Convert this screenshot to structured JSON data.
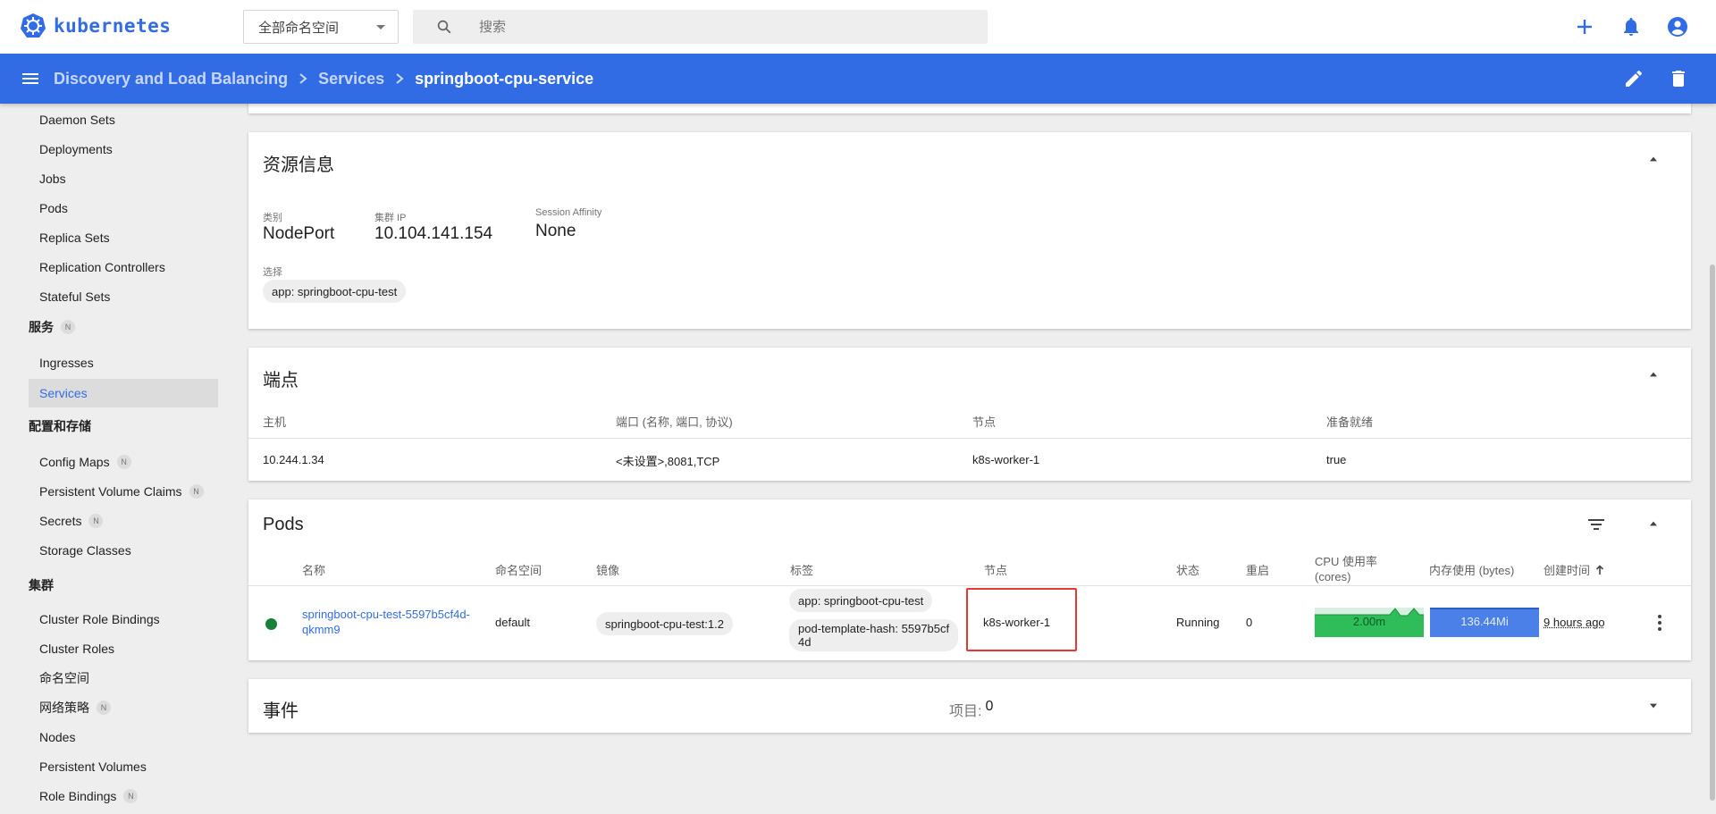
{
  "app": {
    "logo_text": "kubernetes"
  },
  "topbar": {
    "namespace_selected": "全部命名空间",
    "search_placeholder": "搜索"
  },
  "header": {
    "breadcrumbs": [
      "Discovery and Load Balancing",
      "Services",
      "springboot-cpu-service"
    ]
  },
  "sidebar": {
    "items_top": [
      "Daemon Sets",
      "Deployments",
      "Jobs",
      "Pods",
      "Replica Sets",
      "Replication Controllers",
      "Stateful Sets"
    ],
    "section_services": "服务",
    "section_services_badge": "N",
    "services_items": [
      "Ingresses",
      "Services"
    ],
    "section_config": "配置和存储",
    "config_items": [
      {
        "label": "Config Maps",
        "badge": "N"
      },
      {
        "label": "Persistent Volume Claims",
        "badge": "N"
      },
      {
        "label": "Secrets",
        "badge": "N"
      },
      {
        "label": "Storage Classes",
        "badge": ""
      }
    ],
    "section_cluster": "集群",
    "cluster_items": [
      {
        "label": "Cluster Role Bindings",
        "badge": ""
      },
      {
        "label": "Cluster Roles",
        "badge": ""
      },
      {
        "label": "命名空间",
        "badge": ""
      },
      {
        "label": "网络策略",
        "badge": "N"
      },
      {
        "label": "Nodes",
        "badge": ""
      },
      {
        "label": "Persistent Volumes",
        "badge": ""
      },
      {
        "label": "Role Bindings",
        "badge": "N"
      }
    ]
  },
  "resource_info": {
    "title": "资源信息",
    "type_label": "类别",
    "type_value": "NodePort",
    "cluster_ip_label": "集群 IP",
    "cluster_ip_value": "10.104.141.154",
    "session_affinity_label": "Session Affinity",
    "session_affinity_value": "None",
    "selector_label": "选择",
    "selector_chip": "app: springboot-cpu-test"
  },
  "endpoints": {
    "title": "端点",
    "headers": [
      "主机",
      "端口 (名称, 端口, 协议)",
      "节点",
      "准备就绪"
    ],
    "row": [
      "10.244.1.34",
      "<未设置>,8081,TCP",
      "k8s-worker-1",
      "true"
    ]
  },
  "pods": {
    "title": "Pods",
    "headers": {
      "name": "名称",
      "namespace": "命名空间",
      "image": "镜像",
      "labels": "标签",
      "node": "节点",
      "status": "状态",
      "restarts": "重启",
      "cpu_line1": "CPU 使用率",
      "cpu_line2": "(cores)",
      "memory": "内存使用 (bytes)",
      "created": "创建时间"
    },
    "row": {
      "name_line1": "springboot-cpu-test-5597b5cf4d-",
      "name_line2": "qkmm9",
      "namespace": "default",
      "image": "springboot-cpu-test:1.2",
      "label1": "app: springboot-cpu-test",
      "label2_line1": "pod-template-hash: 5597b5cf",
      "label2_line2": "4d",
      "node": "k8s-worker-1",
      "status": "Running",
      "restarts": "0",
      "cpu": "2.00m",
      "memory": "136.44Mi",
      "created": "9 hours ago"
    }
  },
  "events": {
    "title": "事件",
    "items_label": "项目:",
    "items_count": "0"
  },
  "colors": {
    "brand": "#326ce5",
    "running": "#188038",
    "cpu_spark": "#2ebd59",
    "memory_spark": "#4a80e8",
    "highlight": "#e53935"
  }
}
